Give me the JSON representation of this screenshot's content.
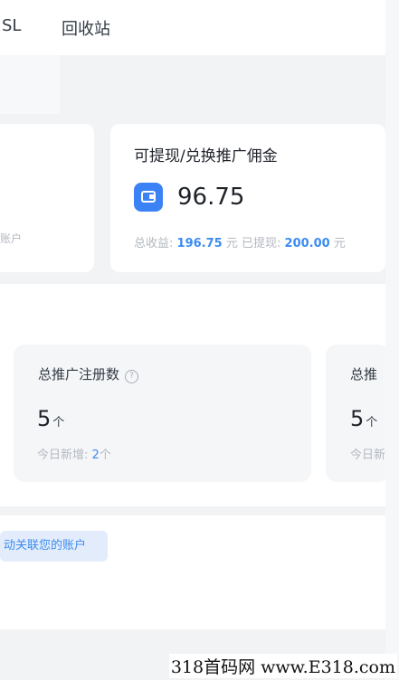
{
  "nav": {
    "tab_ssl": "SL",
    "tab_recycle": "回收站"
  },
  "left_card": {
    "caption": "账户"
  },
  "commission_card": {
    "title": "可提现/兑换推广佣金",
    "wallet_icon": "wallet-icon",
    "balance": "96.75",
    "total_income_label": "总收益:",
    "total_income_value": "196.75",
    "unit_yuan_1": "元",
    "withdrawn_label": "已提现:",
    "withdrawn_value": "200.00",
    "unit_yuan_2": "元"
  },
  "stats": [
    {
      "title": "总推广注册数",
      "help_icon": "?",
      "value": "5",
      "unit": "个",
      "today_label": "今日新增:",
      "today_value": "2",
      "today_unit": "个"
    },
    {
      "title": "总推",
      "value": "5",
      "unit": "个",
      "today_label": "今日新"
    }
  ],
  "link_hint": "动关联您的账户",
  "watermark": "318首码网 www.E318.com",
  "colors": {
    "accent": "#3c8cf0",
    "background": "#f2f3f5",
    "card": "#ffffff"
  }
}
